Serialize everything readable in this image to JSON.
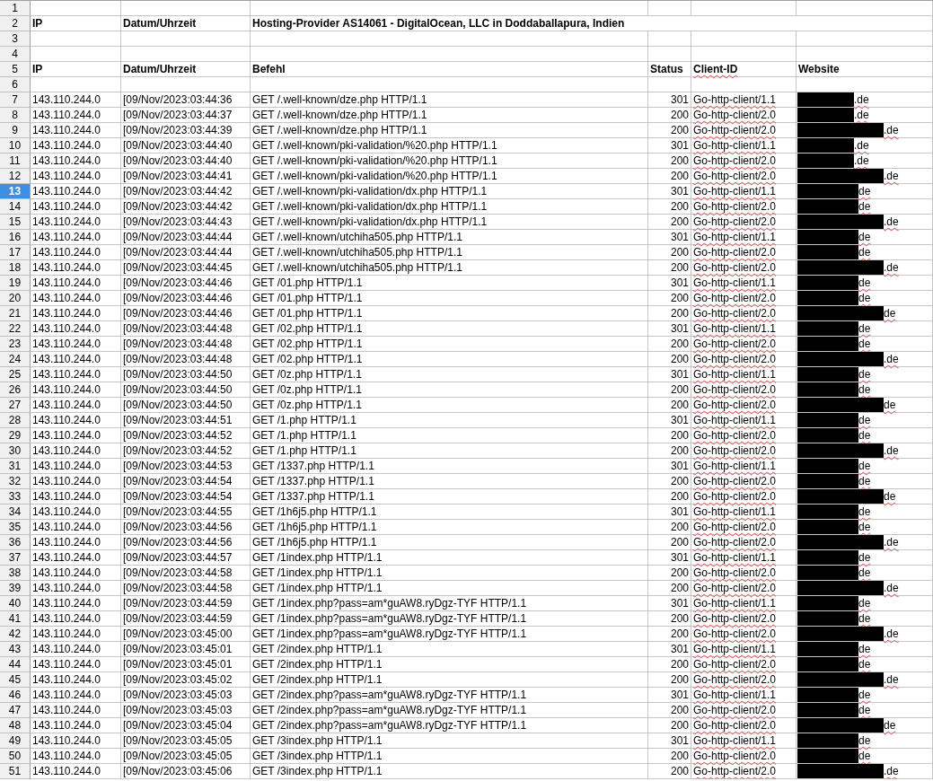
{
  "sheet": {
    "rows": [
      {
        "number": "1",
        "selected": false,
        "kind": "blank"
      },
      {
        "number": "2",
        "selected": false,
        "kind": "heading",
        "cells": [
          "IP",
          "Datum/Uhrzeit",
          "Hosting-Provider AS14061 - DigitalOcean, LLC in Doddaballapura, Indien"
        ]
      },
      {
        "number": "3",
        "selected": false,
        "kind": "blank"
      },
      {
        "number": "4",
        "selected": false,
        "kind": "blank"
      },
      {
        "number": "5",
        "selected": false,
        "kind": "heading",
        "cells": [
          "IP",
          "Datum/Uhrzeit",
          "Befehl",
          "Status",
          "Client-ID",
          "Website"
        ]
      },
      {
        "number": "6",
        "selected": false,
        "kind": "blank"
      },
      {
        "number": "7",
        "selected": false,
        "kind": "entry",
        "ip": "143.110.244.0",
        "time": "[09/Nov/2023:03:44:36",
        "command": "GET /.well-known/dze.php HTTP/1.1",
        "status": "301",
        "client": "Go-http-client/1.1",
        "website": {
          "text": ".de",
          "kind": "short"
        }
      },
      {
        "number": "8",
        "selected": false,
        "kind": "entry",
        "ip": "143.110.244.0",
        "time": "[09/Nov/2023:03:44:37",
        "command": "GET /.well-known/dze.php HTTP/1.1",
        "status": "200",
        "client": "Go-http-client/2.0",
        "website": {
          "text": ".de",
          "kind": "short"
        }
      },
      {
        "number": "9",
        "selected": false,
        "kind": "entry",
        "ip": "143.110.244.0",
        "time": "[09/Nov/2023:03:44:39",
        "command": "GET /.well-known/dze.php HTTP/1.1",
        "status": "200",
        "client": "Go-http-client/2.0",
        "website": {
          "text": ".de",
          "kind": "long"
        }
      },
      {
        "number": "10",
        "selected": false,
        "kind": "entry",
        "ip": "143.110.244.0",
        "time": "[09/Nov/2023:03:44:40",
        "command": "GET /.well-known/pki-validation/%20.php HTTP/1.1",
        "status": "301",
        "client": "Go-http-client/1.1",
        "website": {
          "text": ".de",
          "kind": "short"
        }
      },
      {
        "number": "11",
        "selected": false,
        "kind": "entry",
        "ip": "143.110.244.0",
        "time": "[09/Nov/2023:03:44:40",
        "command": "GET /.well-known/pki-validation/%20.php HTTP/1.1",
        "status": "200",
        "client": "Go-http-client/2.0",
        "website": {
          "text": ".de",
          "kind": "short"
        }
      },
      {
        "number": "12",
        "selected": false,
        "kind": "entry",
        "ip": "143.110.244.0",
        "time": "[09/Nov/2023:03:44:41",
        "command": "GET /.well-known/pki-validation/%20.php HTTP/1.1",
        "status": "200",
        "client": "Go-http-client/2.0",
        "website": {
          "text": ".de",
          "kind": "long"
        }
      },
      {
        "number": "13",
        "selected": true,
        "kind": "entry",
        "ip": "143.110.244.0",
        "time": "[09/Nov/2023:03:44:42",
        "command": "GET /.well-known/pki-validation/dx.php HTTP/1.1",
        "status": "301",
        "client": "Go-http-client/1.1",
        "website": {
          "text": "de",
          "kind": "mid"
        }
      },
      {
        "number": "14",
        "selected": false,
        "kind": "entry",
        "ip": "143.110.244.0",
        "time": "[09/Nov/2023:03:44:42",
        "command": "GET /.well-known/pki-validation/dx.php HTTP/1.1",
        "status": "200",
        "client": "Go-http-client/2.0",
        "website": {
          "text": "de",
          "kind": "mid"
        }
      },
      {
        "number": "15",
        "selected": false,
        "kind": "entry",
        "ip": "143.110.244.0",
        "time": "[09/Nov/2023:03:44:43",
        "command": "GET /.well-known/pki-validation/dx.php HTTP/1.1",
        "status": "200",
        "client": "Go-http-client/2.0",
        "website": {
          "text": ".de",
          "kind": "long"
        }
      },
      {
        "number": "16",
        "selected": false,
        "kind": "entry",
        "ip": "143.110.244.0",
        "time": "[09/Nov/2023:03:44:44",
        "command": "GET /.well-known/utchiha505.php HTTP/1.1",
        "status": "301",
        "client": "Go-http-client/1.1",
        "website": {
          "text": "de",
          "kind": "mid"
        }
      },
      {
        "number": "17",
        "selected": false,
        "kind": "entry",
        "ip": "143.110.244.0",
        "time": "[09/Nov/2023:03:44:44",
        "command": "GET /.well-known/utchiha505.php HTTP/1.1",
        "status": "200",
        "client": "Go-http-client/2.0",
        "website": {
          "text": "de",
          "kind": "mid"
        }
      },
      {
        "number": "18",
        "selected": false,
        "kind": "entry",
        "ip": "143.110.244.0",
        "time": "[09/Nov/2023:03:44:45",
        "command": "GET /.well-known/utchiha505.php HTTP/1.1",
        "status": "200",
        "client": "Go-http-client/2.0",
        "website": {
          "text": ".de",
          "kind": "long"
        }
      },
      {
        "number": "19",
        "selected": false,
        "kind": "entry",
        "ip": "143.110.244.0",
        "time": "[09/Nov/2023:03:44:46",
        "command": "GET /01.php HTTP/1.1",
        "status": "301",
        "client": "Go-http-client/1.1",
        "website": {
          "text": "de",
          "kind": "mid"
        }
      },
      {
        "number": "20",
        "selected": false,
        "kind": "entry",
        "ip": "143.110.244.0",
        "time": "[09/Nov/2023:03:44:46",
        "command": "GET /01.php HTTP/1.1",
        "status": "200",
        "client": "Go-http-client/2.0",
        "website": {
          "text": "de",
          "kind": "mid"
        }
      },
      {
        "number": "21",
        "selected": false,
        "kind": "entry",
        "ip": "143.110.244.0",
        "time": "[09/Nov/2023:03:44:46",
        "command": "GET /01.php HTTP/1.1",
        "status": "200",
        "client": "Go-http-client/2.0",
        "website": {
          "text": "de",
          "kind": "long"
        }
      },
      {
        "number": "22",
        "selected": false,
        "kind": "entry",
        "ip": "143.110.244.0",
        "time": "[09/Nov/2023:03:44:48",
        "command": "GET /02.php HTTP/1.1",
        "status": "301",
        "client": "Go-http-client/1.1",
        "website": {
          "text": "de",
          "kind": "mid"
        }
      },
      {
        "number": "23",
        "selected": false,
        "kind": "entry",
        "ip": "143.110.244.0",
        "time": "[09/Nov/2023:03:44:48",
        "command": "GET /02.php HTTP/1.1",
        "status": "200",
        "client": "Go-http-client/2.0",
        "website": {
          "text": "de",
          "kind": "mid"
        }
      },
      {
        "number": "24",
        "selected": false,
        "kind": "entry",
        "ip": "143.110.244.0",
        "time": "[09/Nov/2023:03:44:48",
        "command": "GET /02.php HTTP/1.1",
        "status": "200",
        "client": "Go-http-client/2.0",
        "website": {
          "text": ".de",
          "kind": "long"
        }
      },
      {
        "number": "25",
        "selected": false,
        "kind": "entry",
        "ip": "143.110.244.0",
        "time": "[09/Nov/2023:03:44:50",
        "command": "GET /0z.php HTTP/1.1",
        "status": "301",
        "client": "Go-http-client/1.1",
        "website": {
          "text": "de",
          "kind": "mid"
        }
      },
      {
        "number": "26",
        "selected": false,
        "kind": "entry",
        "ip": "143.110.244.0",
        "time": "[09/Nov/2023:03:44:50",
        "command": "GET /0z.php HTTP/1.1",
        "status": "200",
        "client": "Go-http-client/2.0",
        "website": {
          "text": "de",
          "kind": "mid"
        }
      },
      {
        "number": "27",
        "selected": false,
        "kind": "entry",
        "ip": "143.110.244.0",
        "time": "[09/Nov/2023:03:44:50",
        "command": "GET /0z.php HTTP/1.1",
        "status": "200",
        "client": "Go-http-client/2.0",
        "website": {
          "text": "de",
          "kind": "long"
        }
      },
      {
        "number": "28",
        "selected": false,
        "kind": "entry",
        "ip": "143.110.244.0",
        "time": "[09/Nov/2023:03:44:51",
        "command": "GET /1.php HTTP/1.1",
        "status": "301",
        "client": "Go-http-client/1.1",
        "website": {
          "text": "de",
          "kind": "mid"
        }
      },
      {
        "number": "29",
        "selected": false,
        "kind": "entry",
        "ip": "143.110.244.0",
        "time": "[09/Nov/2023:03:44:52",
        "command": "GET /1.php HTTP/1.1",
        "status": "200",
        "client": "Go-http-client/2.0",
        "website": {
          "text": "de",
          "kind": "mid"
        }
      },
      {
        "number": "30",
        "selected": false,
        "kind": "entry",
        "ip": "143.110.244.0",
        "time": "[09/Nov/2023:03:44:52",
        "command": "GET /1.php HTTP/1.1",
        "status": "200",
        "client": "Go-http-client/2.0",
        "website": {
          "text": ".de",
          "kind": "long"
        }
      },
      {
        "number": "31",
        "selected": false,
        "kind": "entry",
        "ip": "143.110.244.0",
        "time": "[09/Nov/2023:03:44:53",
        "command": "GET /1337.php HTTP/1.1",
        "status": "301",
        "client": "Go-http-client/1.1",
        "website": {
          "text": "de",
          "kind": "mid"
        }
      },
      {
        "number": "32",
        "selected": false,
        "kind": "entry",
        "ip": "143.110.244.0",
        "time": "[09/Nov/2023:03:44:54",
        "command": "GET /1337.php HTTP/1.1",
        "status": "200",
        "client": "Go-http-client/2.0",
        "website": {
          "text": "de",
          "kind": "mid"
        }
      },
      {
        "number": "33",
        "selected": false,
        "kind": "entry",
        "ip": "143.110.244.0",
        "time": "[09/Nov/2023:03:44:54",
        "command": "GET /1337.php HTTP/1.1",
        "status": "200",
        "client": "Go-http-client/2.0",
        "website": {
          "text": "de",
          "kind": "long"
        }
      },
      {
        "number": "34",
        "selected": false,
        "kind": "entry",
        "ip": "143.110.244.0",
        "time": "[09/Nov/2023:03:44:55",
        "command": "GET /1h6j5.php HTTP/1.1",
        "status": "301",
        "client": "Go-http-client/1.1",
        "website": {
          "text": "de",
          "kind": "mid"
        }
      },
      {
        "number": "35",
        "selected": false,
        "kind": "entry",
        "ip": "143.110.244.0",
        "time": "[09/Nov/2023:03:44:56",
        "command": "GET /1h6j5.php HTTP/1.1",
        "status": "200",
        "client": "Go-http-client/2.0",
        "website": {
          "text": "de",
          "kind": "mid"
        }
      },
      {
        "number": "36",
        "selected": false,
        "kind": "entry",
        "ip": "143.110.244.0",
        "time": "[09/Nov/2023:03:44:56",
        "command": "GET /1h6j5.php HTTP/1.1",
        "status": "200",
        "client": "Go-http-client/2.0",
        "website": {
          "text": ".de",
          "kind": "long"
        }
      },
      {
        "number": "37",
        "selected": false,
        "kind": "entry",
        "ip": "143.110.244.0",
        "time": "[09/Nov/2023:03:44:57",
        "command": "GET /1index.php HTTP/1.1",
        "status": "301",
        "client": "Go-http-client/1.1",
        "website": {
          "text": "de",
          "kind": "mid"
        }
      },
      {
        "number": "38",
        "selected": false,
        "kind": "entry",
        "ip": "143.110.244.0",
        "time": "[09/Nov/2023:03:44:58",
        "command": "GET /1index.php HTTP/1.1",
        "status": "200",
        "client": "Go-http-client/2.0",
        "website": {
          "text": "de",
          "kind": "mid"
        }
      },
      {
        "number": "39",
        "selected": false,
        "kind": "entry",
        "ip": "143.110.244.0",
        "time": "[09/Nov/2023:03:44:58",
        "command": "GET /1index.php HTTP/1.1",
        "status": "200",
        "client": "Go-http-client/2.0",
        "website": {
          "text": ".de",
          "kind": "long"
        }
      },
      {
        "number": "40",
        "selected": false,
        "kind": "entry",
        "ip": "143.110.244.0",
        "time": "[09/Nov/2023:03:44:59",
        "command": "GET /1index.php?pass=am*guAW8.ryDgz-TYF HTTP/1.1",
        "status": "301",
        "client": "Go-http-client/1.1",
        "website": {
          "text": "de",
          "kind": "mid"
        }
      },
      {
        "number": "41",
        "selected": false,
        "kind": "entry",
        "ip": "143.110.244.0",
        "time": "[09/Nov/2023:03:44:59",
        "command": "GET /1index.php?pass=am*guAW8.ryDgz-TYF HTTP/1.1",
        "status": "200",
        "client": "Go-http-client/2.0",
        "website": {
          "text": "de",
          "kind": "mid"
        }
      },
      {
        "number": "42",
        "selected": false,
        "kind": "entry",
        "ip": "143.110.244.0",
        "time": "[09/Nov/2023:03:45:00",
        "command": "GET /1index.php?pass=am*guAW8.ryDgz-TYF HTTP/1.1",
        "status": "200",
        "client": "Go-http-client/2.0",
        "website": {
          "text": ".de",
          "kind": "long"
        }
      },
      {
        "number": "43",
        "selected": false,
        "kind": "entry",
        "ip": "143.110.244.0",
        "time": "[09/Nov/2023:03:45:01",
        "command": "GET /2index.php HTTP/1.1",
        "status": "301",
        "client": "Go-http-client/1.1",
        "website": {
          "text": "de",
          "kind": "mid"
        }
      },
      {
        "number": "44",
        "selected": false,
        "kind": "entry",
        "ip": "143.110.244.0",
        "time": "[09/Nov/2023:03:45:01",
        "command": "GET /2index.php HTTP/1.1",
        "status": "200",
        "client": "Go-http-client/2.0",
        "website": {
          "text": "de",
          "kind": "mid"
        }
      },
      {
        "number": "45",
        "selected": false,
        "kind": "entry",
        "ip": "143.110.244.0",
        "time": "[09/Nov/2023:03:45:02",
        "command": "GET /2index.php HTTP/1.1",
        "status": "200",
        "client": "Go-http-client/2.0",
        "website": {
          "text": ".de",
          "kind": "long"
        }
      },
      {
        "number": "46",
        "selected": false,
        "kind": "entry",
        "ip": "143.110.244.0",
        "time": "[09/Nov/2023:03:45:03",
        "command": "GET /2index.php?pass=am*guAW8.ryDgz-TYF HTTP/1.1",
        "status": "301",
        "client": "Go-http-client/1.1",
        "website": {
          "text": "de",
          "kind": "mid"
        }
      },
      {
        "number": "47",
        "selected": false,
        "kind": "entry",
        "ip": "143.110.244.0",
        "time": "[09/Nov/2023:03:45:03",
        "command": "GET /2index.php?pass=am*guAW8.ryDgz-TYF HTTP/1.1",
        "status": "200",
        "client": "Go-http-client/2.0",
        "website": {
          "text": "de",
          "kind": "mid"
        }
      },
      {
        "number": "48",
        "selected": false,
        "kind": "entry",
        "ip": "143.110.244.0",
        "time": "[09/Nov/2023:03:45:04",
        "command": "GET /2index.php?pass=am*guAW8.ryDgz-TYF HTTP/1.1",
        "status": "200",
        "client": "Go-http-client/2.0",
        "website": {
          "text": "de",
          "kind": "long"
        }
      },
      {
        "number": "49",
        "selected": false,
        "kind": "entry",
        "ip": "143.110.244.0",
        "time": "[09/Nov/2023:03:45:05",
        "command": "GET /3index.php HTTP/1.1",
        "status": "301",
        "client": "Go-http-client/1.1",
        "website": {
          "text": "de",
          "kind": "mid"
        }
      },
      {
        "number": "50",
        "selected": false,
        "kind": "entry",
        "ip": "143.110.244.0",
        "time": "[09/Nov/2023:03:45:05",
        "command": "GET /3index.php HTTP/1.1",
        "status": "200",
        "client": "Go-http-client/2.0",
        "website": {
          "text": "de",
          "kind": "mid"
        }
      },
      {
        "number": "51",
        "selected": false,
        "kind": "entry",
        "ip": "143.110.244.0",
        "time": "[09/Nov/2023:03:45:06",
        "command": "GET /3index.php HTTP/1.1",
        "status": "200",
        "client": "Go-http-client/2.0",
        "website": {
          "text": ".de",
          "kind": "long"
        }
      }
    ]
  }
}
